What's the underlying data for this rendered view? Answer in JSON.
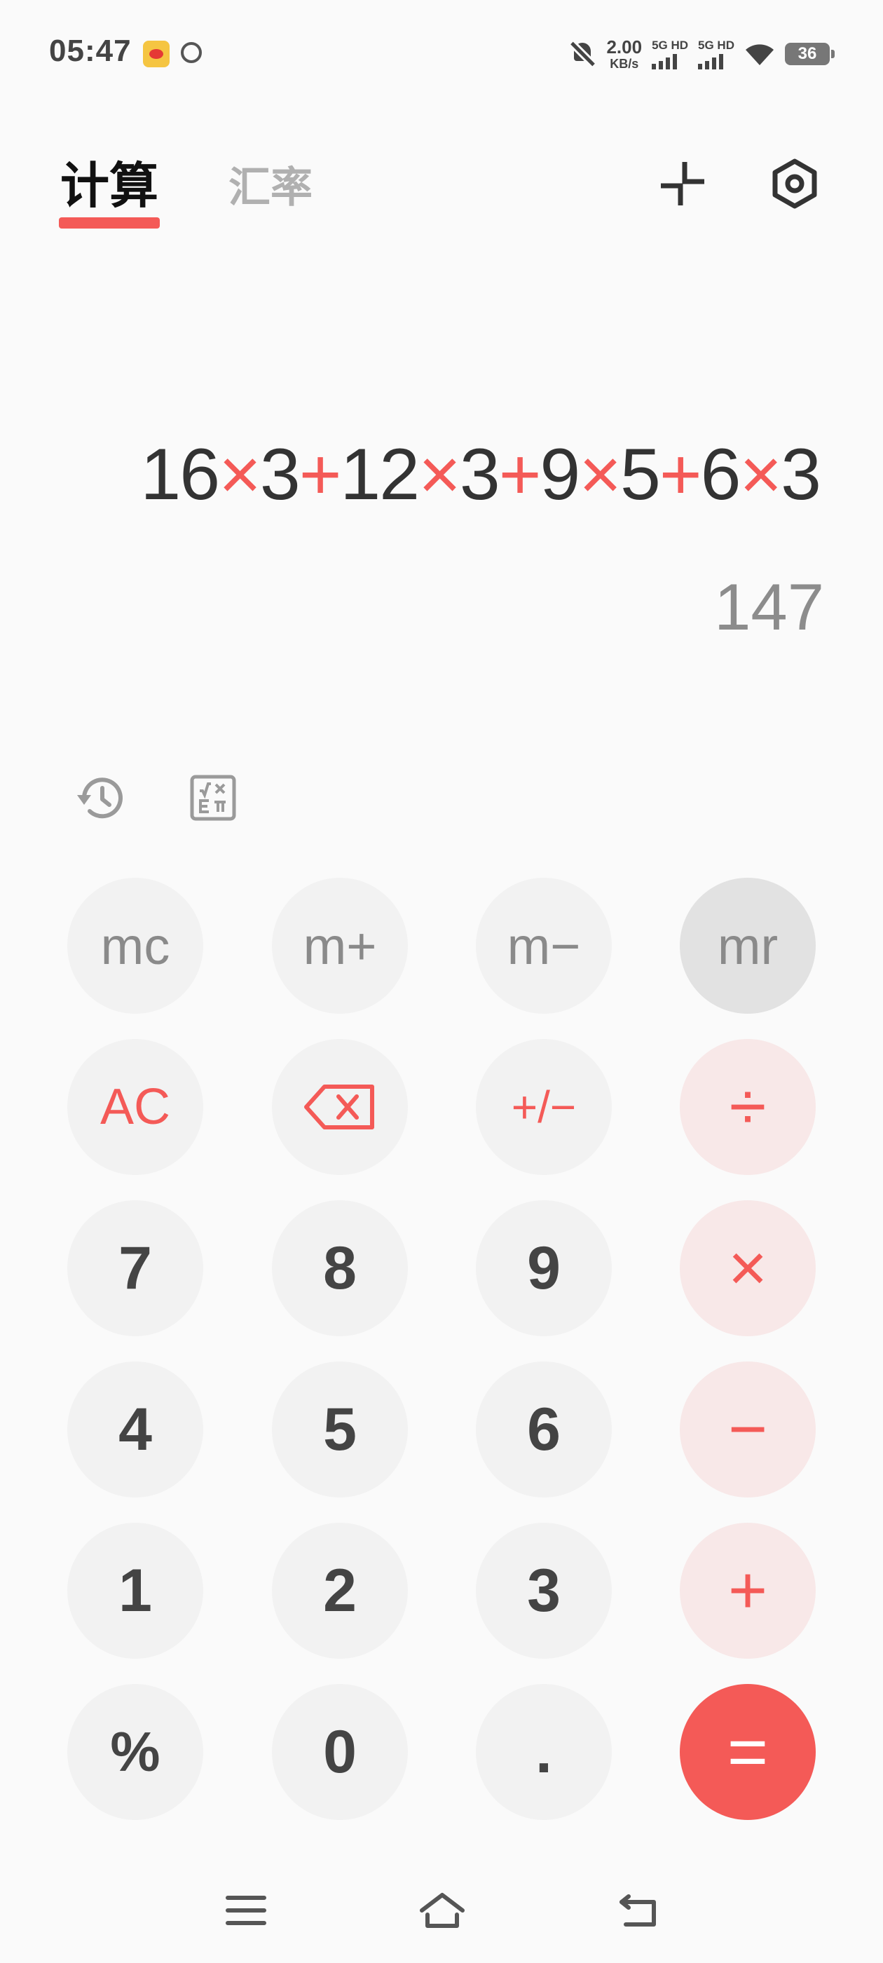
{
  "status_bar": {
    "time": "05:47",
    "net_speed_value": "2.00",
    "net_speed_unit": "KB/s",
    "sim1_label": "5G HD",
    "sim2_label": "5G HD",
    "battery_level": "36"
  },
  "header": {
    "tabs": [
      {
        "label": "计算",
        "active": true
      },
      {
        "label": "汇率",
        "active": false
      }
    ],
    "accent_color": "#f45a57"
  },
  "display": {
    "expression_tokens": [
      "16",
      "×",
      "3",
      "+",
      "12",
      "×",
      "3",
      "+",
      "9",
      "×",
      "5",
      "+",
      "6",
      "×",
      "3"
    ],
    "result": "147"
  },
  "keypad": {
    "mc": "mc",
    "mplus": "m+",
    "mminus": "m−",
    "mr": "mr",
    "ac": "AC",
    "sign": "+/−",
    "divide": "÷",
    "seven": "7",
    "eight": "8",
    "nine": "9",
    "multiply": "×",
    "four": "4",
    "five": "5",
    "six": "6",
    "minus": "−",
    "one": "1",
    "two": "2",
    "three": "3",
    "plus": "+",
    "percent": "%",
    "zero": "0",
    "decimal": ".",
    "equals": "="
  }
}
